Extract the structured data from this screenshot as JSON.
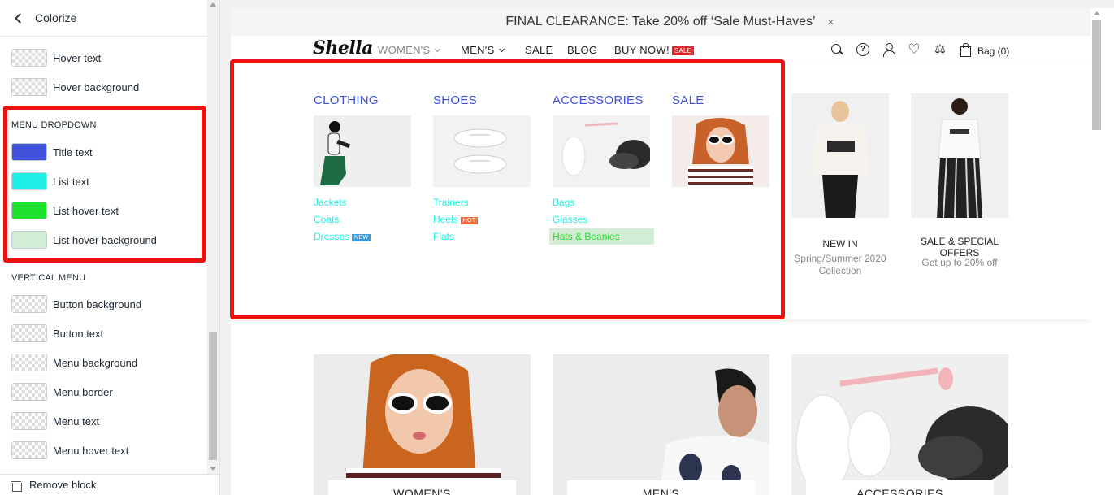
{
  "panel": {
    "title": "Colorize",
    "top_rows": [
      {
        "label": "Hover text"
      },
      {
        "label": "Hover background"
      }
    ],
    "menu_dropdown": {
      "section": "MENU DROPDOWN",
      "rows": [
        {
          "label": "Title text",
          "color": "#3f51d9"
        },
        {
          "label": "List text",
          "color": "#1ff0e6"
        },
        {
          "label": "List hover text",
          "color": "#1fe12e"
        },
        {
          "label": "List hover background",
          "color": "#d3ecd4"
        }
      ]
    },
    "vertical_menu": {
      "section": "VERTICAL MENU",
      "rows": [
        {
          "label": "Button background"
        },
        {
          "label": "Button text"
        },
        {
          "label": "Menu background"
        },
        {
          "label": "Menu border"
        },
        {
          "label": "Menu text"
        },
        {
          "label": "Menu hover text"
        }
      ]
    },
    "footer": {
      "label": "Remove block"
    }
  },
  "store": {
    "announcement": "FINAL CLEARANCE: Take 20% off ‘Sale Must-Haves’",
    "announcement_close": "×",
    "logo": "Shella",
    "nav": {
      "womens": "WOMEN'S",
      "mens": "MEN'S",
      "sale": "SALE",
      "blog": "BLOG",
      "buy_now": "BUY NOW!",
      "buy_now_badge": "SALE",
      "help_glyph": "?",
      "heart_glyph": "♡",
      "compare_glyph": "⚖",
      "bag": "Bag (0)"
    },
    "dropdown": {
      "title_color": "#3f51d9",
      "list_color": "#1ff0e6",
      "hover_text_color": "#1fe12e",
      "hover_bg_color": "#d3ecd4",
      "columns": [
        {
          "title": "CLOTHING",
          "links": [
            {
              "label": "Jackets"
            },
            {
              "label": "Coats"
            },
            {
              "label": "Dresses",
              "tag": "NEW"
            }
          ]
        },
        {
          "title": "SHOES",
          "links": [
            {
              "label": "Trainers"
            },
            {
              "label": "Heels",
              "tag": "HOT"
            },
            {
              "label": "Flats"
            }
          ]
        },
        {
          "title": "ACCESSORIES",
          "links": [
            {
              "label": "Bags"
            },
            {
              "label": "Glasses"
            },
            {
              "label": "Hats & Beanies"
            }
          ]
        },
        {
          "title": "SALE",
          "links": []
        }
      ],
      "featured": [
        {
          "title": "NEW IN",
          "subtitle": "Spring/Summer 2020 Collection"
        },
        {
          "title": "SALE & SPECIAL OFFERS",
          "subtitle": "Get up to 20% off"
        }
      ]
    },
    "banners": [
      {
        "label": "WOMEN'S"
      },
      {
        "label": "MEN'S"
      },
      {
        "label": "ACCESSORIES"
      }
    ]
  }
}
